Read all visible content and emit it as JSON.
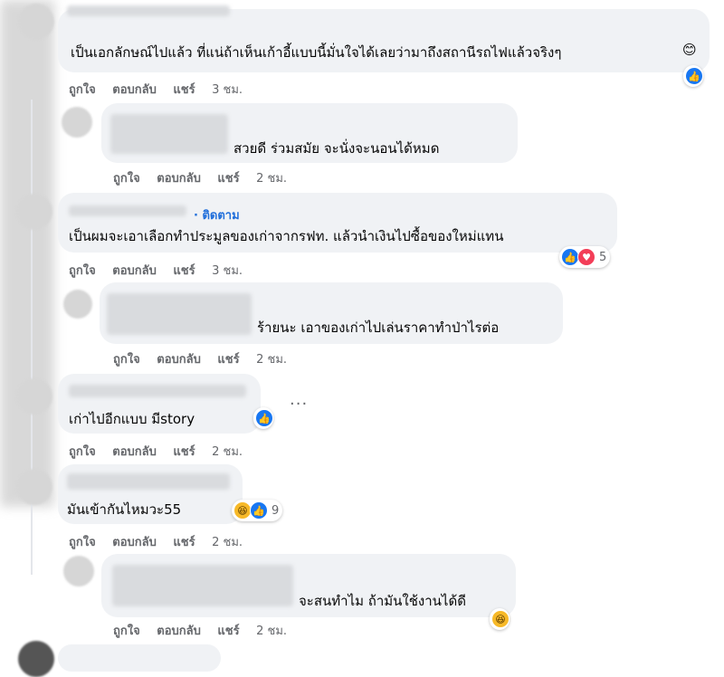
{
  "comments": [
    {
      "text": "เป็นเอกลักษณ์ไปแล้ว ที่แน่ถ้าเห็นเก้าอี้แบบนี้มั่นใจได้เลยว่ามาถึงสถานีรถไฟแล้วจริงๆ",
      "emoji": "😊",
      "like": "ถูกใจ",
      "reply": "ตอบกลับ",
      "share": "แชร์",
      "time": "3 ชม.",
      "reaction_count": ""
    },
    {
      "text": "สวยดี ร่วมสมัย จะนั่งจะนอนได้หมด",
      "like": "ถูกใจ",
      "reply": "ตอบกลับ",
      "share": "แชร์",
      "time": "2 ชม."
    },
    {
      "follow": "· ติดตาม",
      "text": "เป็นผมจะเอาเลือกทำประมูลของเก่าจากรฟท. แล้วนำเงินไปซื้อของใหม่แทน",
      "like": "ถูกใจ",
      "reply": "ตอบกลับ",
      "share": "แชร์",
      "time": "3 ชม.",
      "reaction_count": "5"
    },
    {
      "text": "ร้ายนะ เอาของเก่าไปเล่นราคาทำป่าไรต่อ",
      "like": "ถูกใจ",
      "reply": "ตอบกลับ",
      "share": "แชร์",
      "time": "2 ชม."
    },
    {
      "text": "เก่าไปอีกแบบ มีstory",
      "more": "···",
      "like": "ถูกใจ",
      "reply": "ตอบกลับ",
      "share": "แชร์",
      "time": "2 ชม."
    },
    {
      "text": "มันเข้ากันไหมวะ55",
      "like": "ถูกใจ",
      "reply": "ตอบกลับ",
      "share": "แชร์",
      "time": "2 ชม.",
      "reaction_count": "9"
    },
    {
      "text": "จะสนทำไม ถ้ามันใช้งานได้ดี",
      "like": "ถูกใจ",
      "reply": "ตอบกลับ",
      "share": "แชร์",
      "time": "2 ชม."
    }
  ],
  "icons": {
    "like": "like-icon",
    "love": "love-icon",
    "haha": "haha-icon",
    "more": "more-options-icon"
  },
  "colors": {
    "bubble": "#f0f2f5",
    "like": "#1877f2",
    "love": "#f33e58",
    "haha": "#f7b928",
    "link": "#216fdb",
    "meta": "#65676b"
  }
}
